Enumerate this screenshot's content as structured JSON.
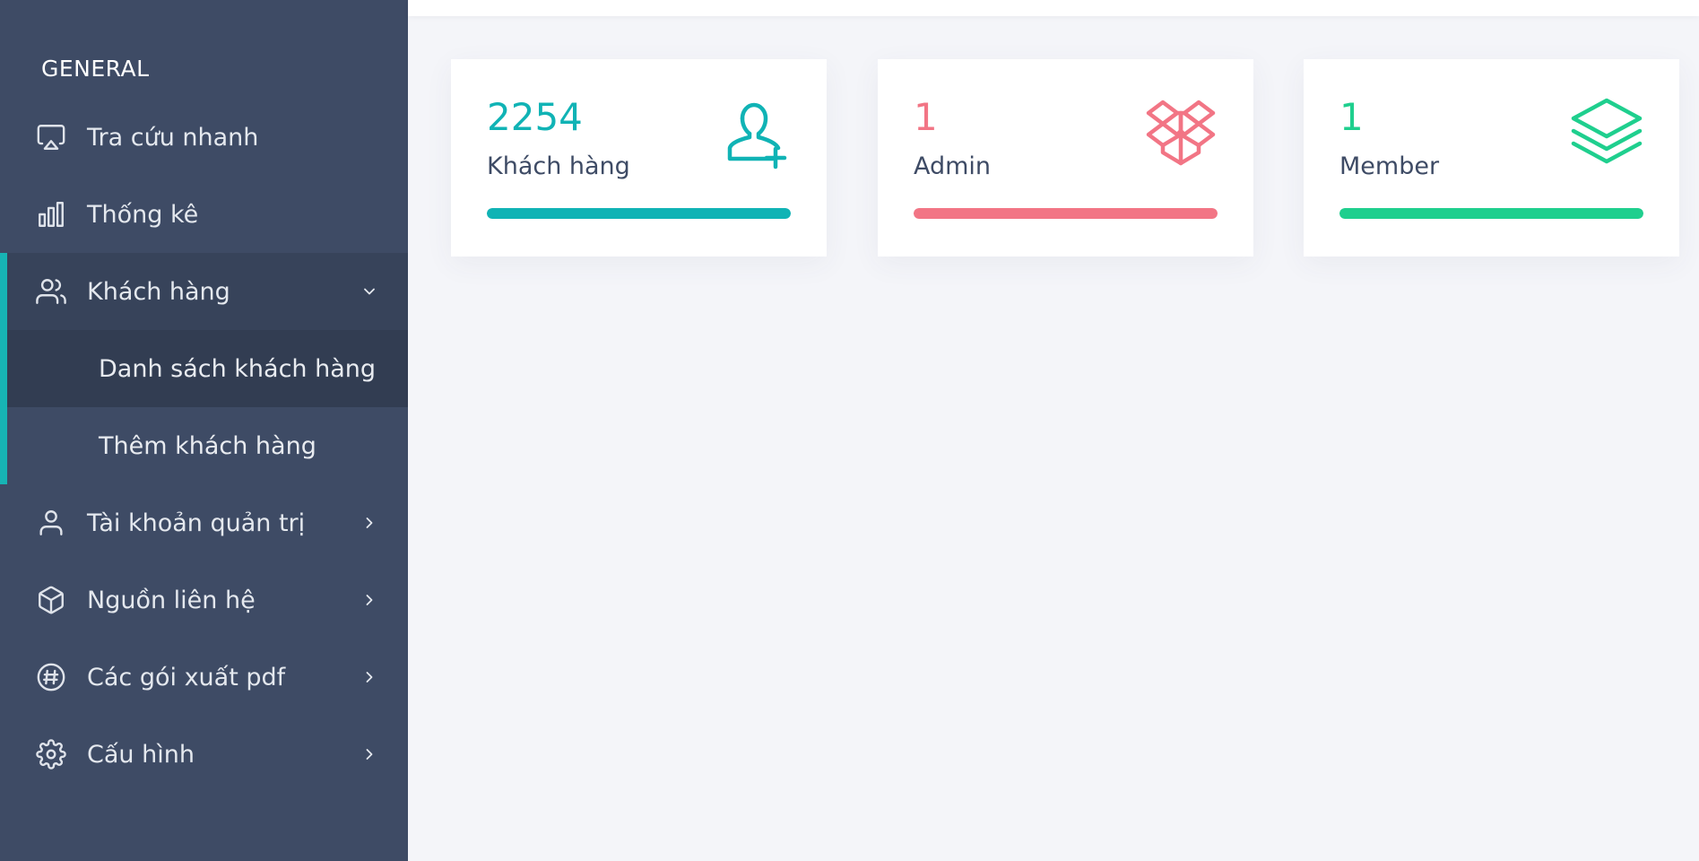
{
  "sidebar": {
    "heading": "GENERAL",
    "items": [
      {
        "label": "Tra cứu nhanh",
        "icon": "airplay-icon"
      },
      {
        "label": "Thống kê",
        "icon": "bar-chart-icon"
      },
      {
        "label": "Khách hàng",
        "icon": "users-icon",
        "expanded": true,
        "children": [
          {
            "label": "Danh sách khách hàng",
            "active": true
          },
          {
            "label": "Thêm khách hàng",
            "active": false
          }
        ]
      },
      {
        "label": "Tài khoản quản trị",
        "icon": "user-icon"
      },
      {
        "label": "Nguồn liên hệ",
        "icon": "box-icon"
      },
      {
        "label": "Các gói xuất pdf",
        "icon": "hash-icon"
      },
      {
        "label": "Cấu hình",
        "icon": "settings-icon"
      }
    ]
  },
  "cards": [
    {
      "count": "2254",
      "label": "Khách hàng",
      "icon": "user-plus-icon",
      "color": "#10b3b5",
      "progress_percent": 100
    },
    {
      "count": "1",
      "label": "Admin",
      "icon": "dropbox-icon",
      "color": "#f27585",
      "progress_percent": 100
    },
    {
      "count": "1",
      "label": "Member",
      "icon": "layers-icon",
      "color": "#1fcf8e",
      "progress_percent": 100
    }
  ],
  "colors": {
    "sidebar_bg": "#3e4b65",
    "accent": "#17b4b4",
    "content_bg": "#f4f5f9"
  }
}
